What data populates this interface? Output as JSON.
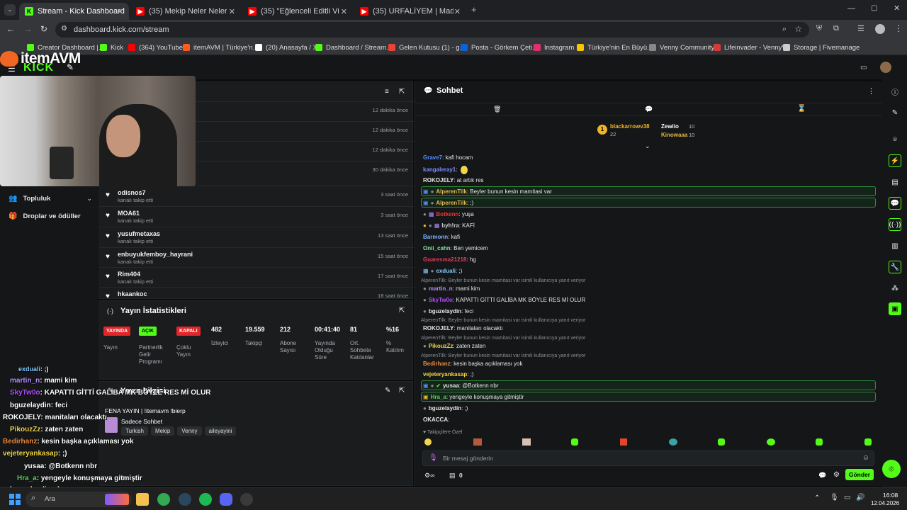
{
  "browser": {
    "tabs": [
      {
        "label": "Stream - Kick Dashboard",
        "icon": "kick-icon",
        "active": true
      },
      {
        "label": "(35) Mekip Neler Neler 62.Bölü",
        "icon": "youtube-icon"
      },
      {
        "label": "(35) \"Eğlenceli Editli Video\" Kic",
        "icon": "youtube-icon"
      },
      {
        "label": "(35) URFALİYEM | Madara Oldu",
        "icon": "youtube-icon"
      }
    ],
    "url": "dashboard.kick.com/stream",
    "bookmarks": [
      {
        "label": "Creator Dashboard |...",
        "color": "#53fc18"
      },
      {
        "label": "Kick",
        "color": "#53fc18"
      },
      {
        "label": "(364) YouTube",
        "color": "#ff0000"
      },
      {
        "label": "itemAVM | Türkiye'n...",
        "color": "#ff5a1f"
      },
      {
        "label": "(20) Anasayfa / X",
        "color": "#ffffff"
      },
      {
        "label": "Dashboard / Stream...",
        "color": "#53fc18"
      },
      {
        "label": "Gelen Kutusu (1) - g...",
        "color": "#ea4335"
      },
      {
        "label": "Posta - Görkem Çeti...",
        "color": "#0a64d8"
      },
      {
        "label": "Instagram",
        "color": "#e1306c"
      },
      {
        "label": "Türkiye'nin En Büyü...",
        "color": "#f7c600"
      },
      {
        "label": "Venny Community",
        "color": "#888888"
      },
      {
        "label": "Lifeinvader - VennyV",
        "color": "#d83a3a"
      },
      {
        "label": "Storage | Fivemanage",
        "color": "#cccccc"
      }
    ]
  },
  "overlay": {
    "logo_text": "itemAVM",
    "kick_text": "KICK"
  },
  "sidebar": {
    "items": [
      {
        "label": "Topluluk",
        "icon": "users-icon"
      },
      {
        "label": "Droplar ve ödüller",
        "icon": "gift-icon"
      }
    ]
  },
  "activity": {
    "recent_times": [
      "12 dakika önce",
      "12 dakika önce",
      "12 dakika önce",
      "30 dakika önce"
    ],
    "rows": [
      {
        "name": "odisnos7",
        "sub": "kanalı takip etti",
        "time": "3 saat önce"
      },
      {
        "name": "MOA61",
        "sub": "kanalı takip etti",
        "time": "3 saat önce"
      },
      {
        "name": "yusufmetaxas",
        "sub": "kanalı takip etti",
        "time": "13 saat önce"
      },
      {
        "name": "enbuyukfemboy_hayrani",
        "sub": "kanalı takip etti",
        "time": "15 saat önce"
      },
      {
        "name": "Rim404",
        "sub": "kanalı takip etti",
        "time": "17 saat önce"
      },
      {
        "name": "hkaankoc",
        "sub": "",
        "time": "18 saat önce"
      }
    ]
  },
  "stats": {
    "title": "Yayın İstatistikleri",
    "badges": [
      {
        "badge": "YAYINDA",
        "label": "Yayın",
        "color": "#e3262a"
      },
      {
        "badge": "AÇIK",
        "label": "Partnerlik Gelir Programı",
        "color": "#53fc18"
      },
      {
        "badge": "KAPALI",
        "label": "Çoklu Yayın",
        "color": "#e3262a"
      }
    ],
    "values": [
      {
        "value": "482",
        "label": "İzleyici"
      },
      {
        "value": "19.559",
        "label": "Takipçi"
      },
      {
        "value": "212",
        "label": "Abone Sayısı"
      },
      {
        "value": "00:41:40",
        "label": "Yayında Olduğu Süre"
      },
      {
        "value": "81",
        "label": "Ort. Sohbete Katılanlar"
      },
      {
        "value": "%16",
        "label": "% Katılım"
      }
    ]
  },
  "stream_info": {
    "title": "Yayın bilgisi",
    "stream_title": "FENA YAYIN | !itemavm !bierp",
    "chat_mode": "Sadece Sohbet",
    "tags": [
      "Turkish",
      "Mekip",
      "Venny",
      "aileyayini"
    ]
  },
  "chat": {
    "title": "Sohbet",
    "leaderboard": [
      {
        "rank": "1",
        "name": "blackarrowv38",
        "count": "22"
      },
      {
        "name": "Zewiio",
        "count": "10"
      },
      {
        "name": "Kinowaaa",
        "count": "10"
      }
    ],
    "messages": [
      {
        "user": "Grave7",
        "color": "#5b8cff",
        "text": ": kafi hocam"
      },
      {
        "user": "kangaleray1",
        "color": "#7c8cff",
        "text": ":"
      },
      {
        "user": "ROKOJELY",
        "color": "#e6e6e6",
        "text": ": at artık res"
      },
      {
        "user": "AlperenTilk",
        "color": "#e4b74b",
        "text": ": Beyler bunun kesin mamitasi var",
        "highlight": true
      },
      {
        "user": "AlperenTilk",
        "color": "#e4b74b",
        "text": ": ;)",
        "highlight": true
      },
      {
        "user": "Botkenn",
        "color": "#e53a3a",
        "text": ": yuşa"
      },
      {
        "user": "byh!ra",
        "color": "#cfcfcf",
        "text": ": KAFİ"
      },
      {
        "user": "Barmonn",
        "color": "#7fb2ff",
        "text": ": kafi"
      },
      {
        "user": "Onii_cahn",
        "color": "#7fe1a5",
        "text": ": Ben yemicem"
      },
      {
        "user": "Guaresma21218",
        "color": "#e53a5a",
        "text": ": hg"
      },
      {
        "user": "exduali",
        "color": "#7fc8ff",
        "text": ": ;)"
      },
      {
        "reply": "AlperenTilk: Beyler bunun kesin mamitasi var isimli kullanıcıya yanıt veriyor"
      },
      {
        "user": "martin_n",
        "color": "#b48cff",
        "text": ": mami kim"
      },
      {
        "user": "SkyTw0o",
        "color": "#b44cff",
        "text": ": KAPATTI GİTTİ GALİBA MK BÖYLE RES Mİ OLUR"
      },
      {
        "user": "bguzelaydin",
        "color": "#e6e6e6",
        "text": ": feci"
      },
      {
        "user": "ROKOJELY",
        "color": "#e6e6e6",
        "text": ": manitaları olacaktı"
      },
      {
        "reply": "AlperenTilk: Beyler bunun kesin mamitasi var isimli kullanıcıya yanıt veriyor"
      },
      {
        "user": "PikouzZz",
        "color": "#f0d64b",
        "text": ": zaten zaten"
      },
      {
        "reply": "AlperenTilk: Beyler bunun kesin mamitasi var isimli kullanıcıya yanıt veriyor"
      },
      {
        "user": "Bedirhanz",
        "color": "#f08a3a",
        "text": ": kesin başka açıklaması yok"
      },
      {
        "user": "vejeteryankasap",
        "color": "#f0d64b",
        "text": ": ;)"
      },
      {
        "user": "yusaa",
        "color": "#e6e6e6",
        "text": ": @Botkenn nbr",
        "highlight": true
      },
      {
        "user": "Hra_a",
        "color": "#5bd15b",
        "text": ": yengeyle konuşmaya gitmiştir",
        "highlight": true
      },
      {
        "user": "bguzelaydin",
        "color": "#e6e6e6",
        "text": ": ;)"
      },
      {
        "user": "OKACCA",
        "color": "#cfcfcf",
        "text": ":"
      }
    ],
    "follower_only": "Takipçilere Özel",
    "input_placeholder": "Bir mesaj gönderin",
    "send_label": "Gönder",
    "footer_count": "0"
  },
  "overlay_chat": [
    {
      "user": "exduali",
      "color": "#7fc8ff",
      "text": ": ;)"
    },
    {
      "user": "martin_n",
      "color": "#b48cff",
      "text": ": mami kim"
    },
    {
      "user": "SkyTw0o",
      "color": "#b44cff",
      "text": ": KAPATTI GİTTİ GALİBA MK BÖYLE RES Mİ OLUR"
    },
    {
      "user": "bguzelaydin",
      "color": "#ffffff",
      "text": ": feci"
    },
    {
      "user": "ROKOJELY",
      "color": "#ffffff",
      "text": ": manitaları olacaktı"
    },
    {
      "user": "PikouzZz",
      "color": "#f0d64b",
      "text": ": zaten zaten"
    },
    {
      "user": "Bedirhanz",
      "color": "#f08a3a",
      "text": ": kesin başka açıklaması yok"
    },
    {
      "user": "vejeteryankasap",
      "color": "#f0d64b",
      "text": ": ;)"
    },
    {
      "user": "yusaa",
      "color": "#ffffff",
      "text": ": @Botkenn nbr"
    },
    {
      "user": "Hra_a",
      "color": "#5bd15b",
      "text": ": yengeyle konuşmaya gitmiştir"
    },
    {
      "user": "bguzelaydin",
      "color": "#ffffff",
      "text": ": ;)"
    }
  ],
  "taskbar": {
    "search_placeholder": "Ara",
    "time": "16:08",
    "date": "12.04.2026"
  },
  "colors": {
    "accent": "#53fc18",
    "live": "#e3262a"
  }
}
